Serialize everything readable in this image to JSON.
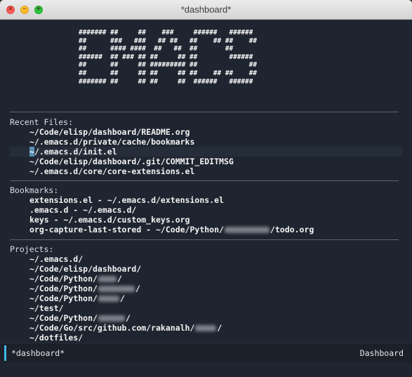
{
  "window": {
    "title": "*dashboard*"
  },
  "banner": "####### ##     ##    ###     ######   ######\n##      ###   ###   ## ##   ##    ## ##    ##\n##      #### ####  ##   ##  ##       ##\n######  ## ### ## ##     ## ##        ######\n##      ##     ## ######### ##             ##\n##      ##     ## ##     ## ##    ## ##    ##\n####### ##     ## ##     ##  ######   ######",
  "recent_files": {
    "title": "Recent Files:",
    "items": [
      "~/Code/elisp/dashboard/README.org",
      "~/.emacs.d/private/cache/bookmarks",
      "~/.emacs.d/init.el",
      "~/Code/elisp/dashboard/.git/COMMIT_EDITMSG",
      "~/.emacs.d/core/core-extensions.el"
    ]
  },
  "bookmarks": {
    "title": "Bookmarks:",
    "items": [
      "extensions.el - ~/.emacs.d/extensions.el",
      ".emacs.d - ~/.emacs.d/",
      "keys - ~/.emacs.d/custom_keys.org"
    ],
    "last_item_prefix": "org-capture-last-stored - ~/Code/Python/",
    "last_item_suffix": "/todo.org"
  },
  "projects": {
    "title": "Projects:",
    "item1": "~/.emacs.d/",
    "item2": "~/Code/elisp/dashboard/",
    "python_prefix": "~/Code/Python/",
    "slash": "/",
    "test": "~/test/",
    "go_prefix": "~/Code/Go/src/github.com/rakanalh/",
    "dotfiles": "~/dotfiles/"
  },
  "modeline": {
    "buffer_name": "*dashboard*",
    "mode_name": "Dashboard"
  }
}
